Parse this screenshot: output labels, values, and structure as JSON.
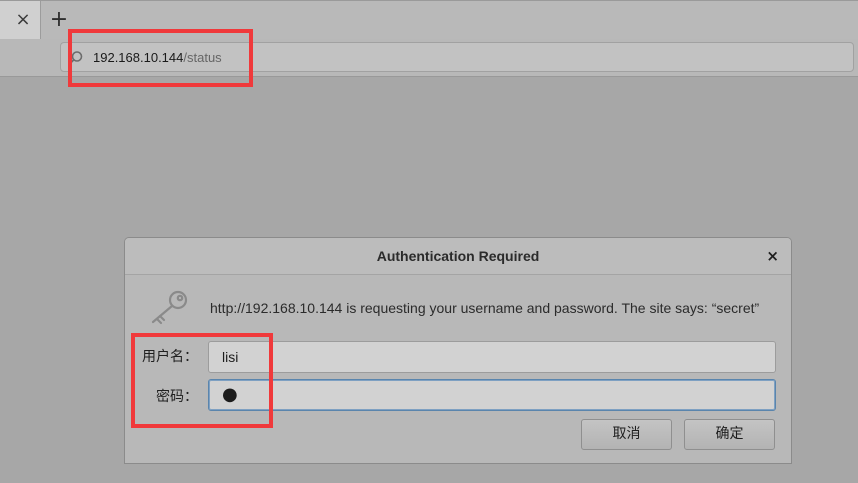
{
  "browser": {
    "tab_close_glyph": "×",
    "new_tab_glyph": "+",
    "url_host": "192.168.10.144",
    "url_path": "/status",
    "search_icon": "search-icon"
  },
  "dialog": {
    "title": "Authentication Required",
    "close_glyph": "×",
    "icon": "key-icon",
    "message": "http://192.168.10.144 is requesting your username and password. The site says: “secret”",
    "username_label": "用户名：",
    "username_value": "lisi",
    "password_label": "密码：",
    "password_value": "●",
    "cancel_label": "取消",
    "ok_label": "确定"
  },
  "colors": {
    "annotation": "#f0393b",
    "background": "#a7a7a7",
    "focus_border": "#5a85ad"
  }
}
